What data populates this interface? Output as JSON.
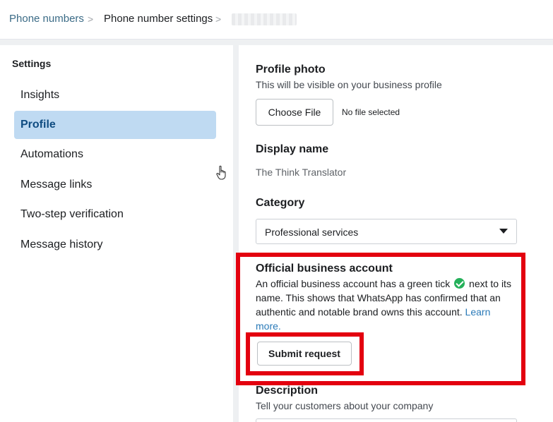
{
  "breadcrumb": {
    "items": [
      {
        "label": "Phone numbers"
      },
      {
        "label": "Phone number settings"
      }
    ],
    "separator": ">",
    "current_number": ""
  },
  "sidebar": {
    "heading": "Settings",
    "items": [
      {
        "label": "Insights",
        "active": false
      },
      {
        "label": "Profile",
        "active": true
      },
      {
        "label": "Automations",
        "active": false
      },
      {
        "label": "Message links",
        "active": false
      },
      {
        "label": "Two-step verification",
        "active": false
      },
      {
        "label": "Message history",
        "active": false
      }
    ]
  },
  "profile_photo": {
    "title": "Profile photo",
    "subtitle": "This will be visible on your business profile",
    "button_label": "Choose File",
    "file_status": "No file selected"
  },
  "display_name": {
    "title": "Display name",
    "value": "The Think Translator"
  },
  "category": {
    "title": "Category",
    "selected": "Professional services"
  },
  "official_account": {
    "title": "Official business account",
    "text_before_tick": "An official business account has a green tick",
    "text_after_tick": "next to its name. This shows that WhatsApp has confirmed that an authentic and notable brand owns this account.",
    "learn_more": "Learn more.",
    "button_label": "Submit request"
  },
  "description": {
    "title": "Description",
    "subtitle": "Tell your customers about your company"
  },
  "colors": {
    "active_bg": "#bfdaf2",
    "link": "#2a7ab8",
    "highlight": "#e3000f",
    "tick": "#25b05a"
  }
}
